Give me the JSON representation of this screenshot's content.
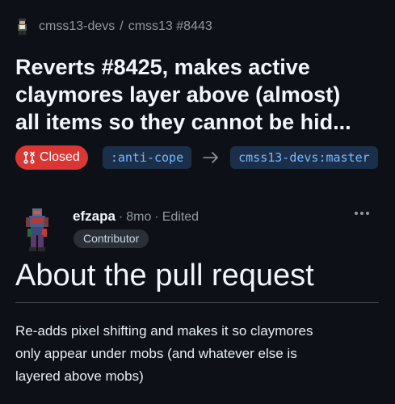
{
  "breadcrumb": {
    "owner": "cmss13-devs",
    "separator": "/",
    "repo_and_number": "cmss13 #8443"
  },
  "pull_request": {
    "title_lines": [
      "Reverts #8425, makes active",
      "claymores layer above (almost)",
      "all items so they cannot be hid..."
    ],
    "state_label": "Closed",
    "state_icon": "pull-request-closed-icon",
    "head_branch": ":anti-cope",
    "base_branch": "cmss13-devs:master"
  },
  "comment": {
    "author": "efzapa",
    "separator": "·",
    "age": "8mo",
    "edited_separator": "·",
    "edited_label": "Edited",
    "role": "Contributor",
    "heading": "About the pull request",
    "body_lines": [
      "Re-adds pixel shifting and makes it so claymores",
      "only appear under mobs (and whatever else is",
      "layered above mobs)"
    ]
  },
  "colors": {
    "background": "#0d1117",
    "closed_red": "#da3633",
    "branch_bg": "#1c2f4a",
    "branch_text": "#79b8ff",
    "muted_text": "#9198a1"
  }
}
